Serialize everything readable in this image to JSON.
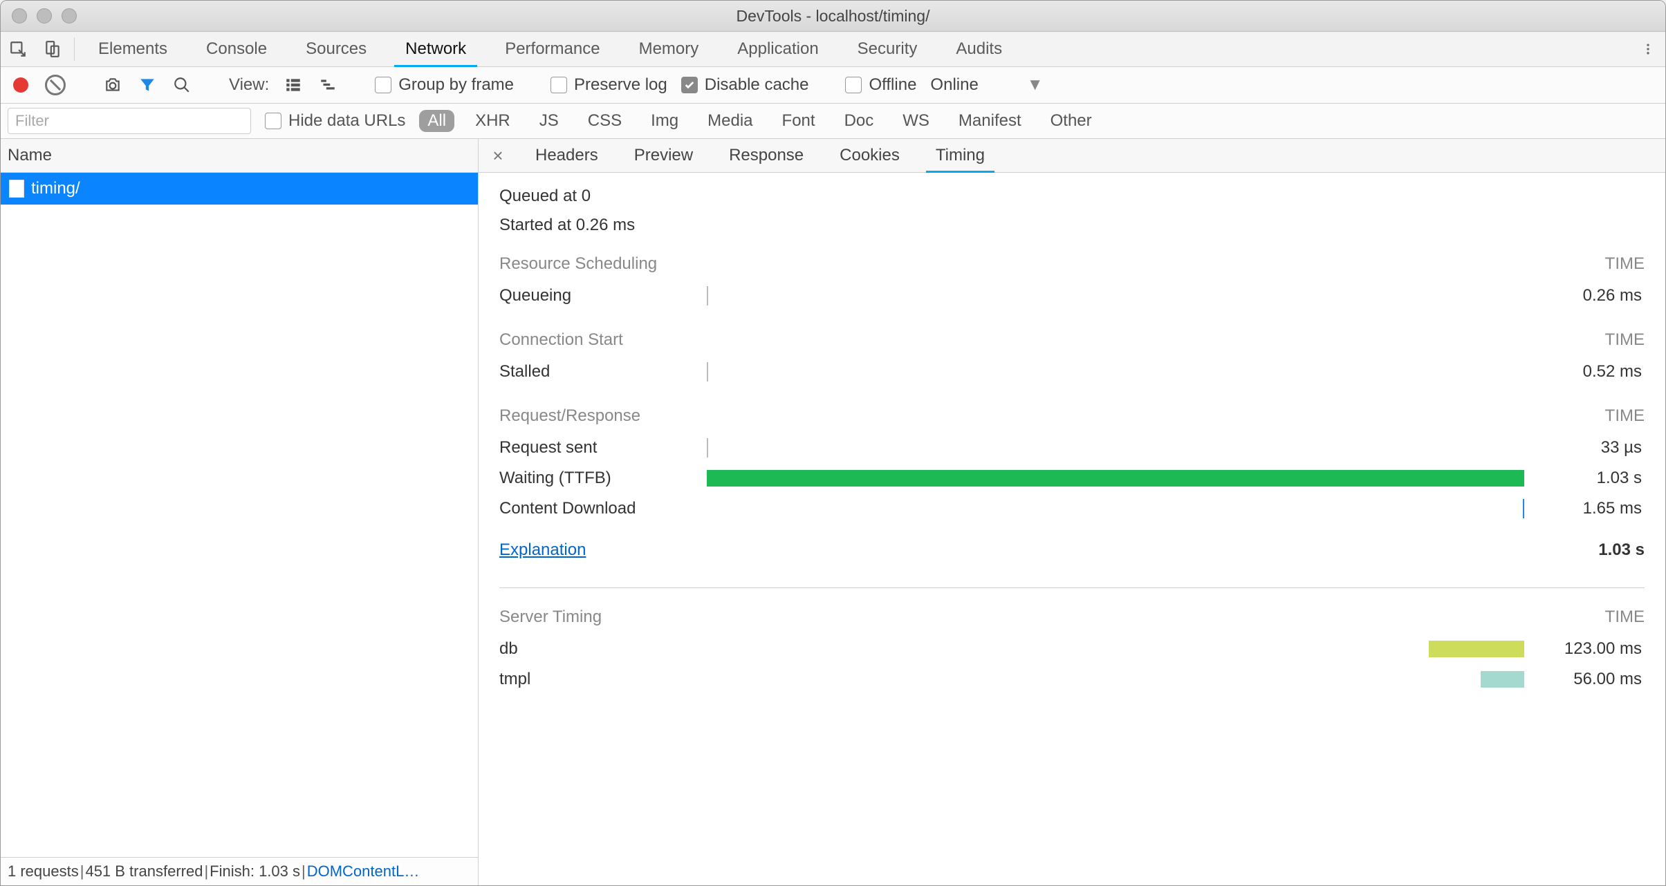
{
  "window": {
    "title": "DevTools - localhost/timing/"
  },
  "main_tabs": {
    "items": [
      "Elements",
      "Console",
      "Sources",
      "Network",
      "Performance",
      "Memory",
      "Application",
      "Security",
      "Audits"
    ],
    "active": "Network"
  },
  "net_toolbar": {
    "view_label": "View:",
    "group_by_frame": "Group by frame",
    "preserve_log": "Preserve log",
    "disable_cache": "Disable cache",
    "disable_cache_checked": true,
    "offline": "Offline",
    "online_label": "Online"
  },
  "filter_bar": {
    "placeholder": "Filter",
    "value": "",
    "hide_data_urls": "Hide data URLs",
    "types": [
      "All",
      "XHR",
      "JS",
      "CSS",
      "Img",
      "Media",
      "Font",
      "Doc",
      "WS",
      "Manifest",
      "Other"
    ],
    "active_type": "All"
  },
  "request_list": {
    "column_header": "Name",
    "items": [
      {
        "name": "timing/",
        "selected": true
      }
    ]
  },
  "status": {
    "requests": "1 requests",
    "transferred": "451 B transferred",
    "finish": "Finish: 1.03 s",
    "domcontent": "DOMContentL…"
  },
  "detail_tabs": {
    "items": [
      "Headers",
      "Preview",
      "Response",
      "Cookies",
      "Timing"
    ],
    "active": "Timing"
  },
  "timing": {
    "queued": "Queued at 0",
    "started": "Started at 0.26 ms",
    "time_col_label": "TIME",
    "sections": [
      {
        "title": "Resource Scheduling",
        "rows": [
          {
            "label": "Queueing",
            "value": "0.26 ms",
            "bar": {
              "left_pct": 0,
              "width_pct": 0.2,
              "color": "#bbb",
              "tick": true
            }
          }
        ]
      },
      {
        "title": "Connection Start",
        "rows": [
          {
            "label": "Stalled",
            "value": "0.52 ms",
            "bar": {
              "left_pct": 0,
              "width_pct": 0.2,
              "color": "#bbb",
              "tick": true
            }
          }
        ]
      },
      {
        "title": "Request/Response",
        "rows": [
          {
            "label": "Request sent",
            "value": "33 µs",
            "bar": {
              "left_pct": 0,
              "width_pct": 0.2,
              "color": "#bbb",
              "tick": true
            }
          },
          {
            "label": "Waiting (TTFB)",
            "value": "1.03 s",
            "bar": {
              "left_pct": 0,
              "width_pct": 100,
              "color": "#1db954"
            }
          },
          {
            "label": "Content Download",
            "value": "1.65 ms",
            "bar": {
              "left_pct": 99.8,
              "width_pct": 0.2,
              "color": "#1e88e5",
              "tick": true
            }
          }
        ]
      }
    ],
    "explanation": {
      "label": "Explanation",
      "total": "1.03 s"
    },
    "server_timing": {
      "title": "Server Timing",
      "rows": [
        {
          "label": "db",
          "value": "123.00 ms",
          "bar": {
            "left_pct": 88.3,
            "width_pct": 11.7,
            "color": "#cddc5a"
          }
        },
        {
          "label": "tmpl",
          "value": "56.00 ms",
          "bar": {
            "left_pct": 94.7,
            "width_pct": 5.3,
            "color": "#a3d9cf"
          }
        }
      ]
    }
  }
}
